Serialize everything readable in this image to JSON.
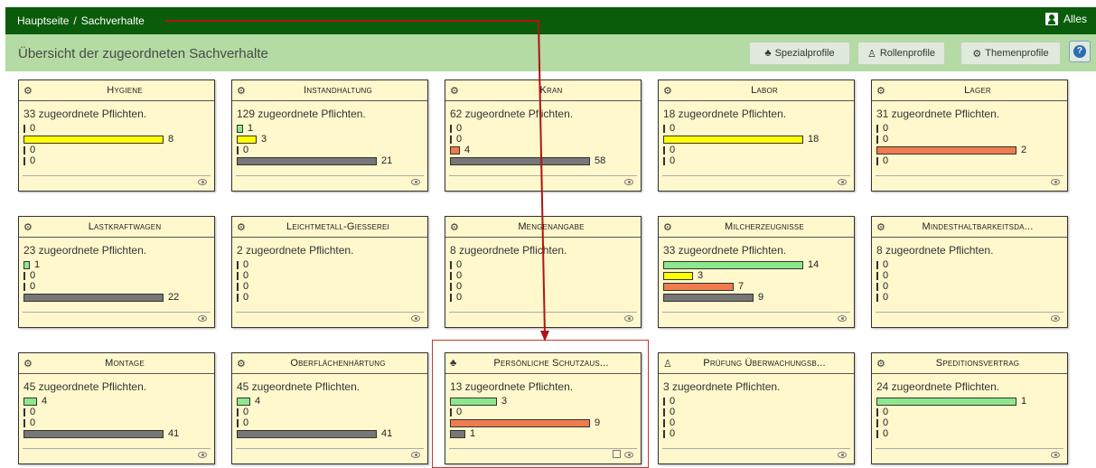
{
  "topbar": {
    "home": "Hauptseite",
    "separator": "/",
    "current": "Sachverhalte",
    "user": "Alles"
  },
  "subbar": {
    "title": "Übersicht der zugeordneten Sachverhalte",
    "buttons": [
      "Spezialprofile",
      "Rollenprofile",
      "Themenprofile"
    ]
  },
  "colors": {
    "green": "#8de88d",
    "yellow": "#ffff00",
    "red": "#f07b4f",
    "gray": "#777777"
  },
  "cards": [
    {
      "title": "Hygiene",
      "icon": "gears-icon",
      "count": "33 zugeordnete Pflichten.",
      "bars": [
        0,
        8,
        0,
        0
      ],
      "edit": false
    },
    {
      "title": "Instandhaltung",
      "icon": "gears-icon",
      "count": "129 zugeordnete Pflichten.",
      "bars": [
        1,
        3,
        0,
        21
      ],
      "edit": false
    },
    {
      "title": "Kran",
      "icon": "gears-icon",
      "count": "62 zugeordnete Pflichten.",
      "bars": [
        0,
        0,
        4,
        58
      ],
      "edit": false
    },
    {
      "title": "Labor",
      "icon": "gears-icon",
      "count": "18 zugeordnete Pflichten.",
      "bars": [
        0,
        18,
        0,
        0
      ],
      "edit": false
    },
    {
      "title": "Lager",
      "icon": "gears-icon",
      "count": "31 zugeordnete Pflichten.",
      "bars": [
        0,
        0,
        2,
        0
      ],
      "edit": false
    },
    {
      "title": "Lastkraftwagen",
      "icon": "gears-icon",
      "count": "23 zugeordnete Pflichten.",
      "bars": [
        1,
        0,
        0,
        22
      ],
      "edit": false
    },
    {
      "title": "Leichtmetall-Gießerei",
      "icon": "gears-icon",
      "count": "2 zugeordnete Pflichten.",
      "bars": [
        0,
        0,
        0,
        0
      ],
      "edit": false
    },
    {
      "title": "Mengenangabe",
      "icon": "gears-icon",
      "count": "8 zugeordnete Pflichten.",
      "bars": [
        0,
        0,
        0,
        0
      ],
      "edit": false
    },
    {
      "title": "Milcherzeugnisse",
      "icon": "gears-icon",
      "count": "33 zugeordnete Pflichten.",
      "bars": [
        14,
        3,
        7,
        9
      ],
      "edit": false
    },
    {
      "title": "Mindesthaltbarkeitsda...",
      "icon": "gears-icon",
      "count": "8 zugeordnete Pflichten.",
      "bars": [
        0,
        0,
        0,
        0
      ],
      "edit": false
    },
    {
      "title": "Montage",
      "icon": "gears-icon",
      "count": "45 zugeordnete Pflichten.",
      "bars": [
        4,
        0,
        0,
        41
      ],
      "edit": false
    },
    {
      "title": "Oberflächenhärtung",
      "icon": "gears-icon",
      "count": "45 zugeordnete Pflichten.",
      "bars": [
        4,
        0,
        0,
        41
      ],
      "edit": false
    },
    {
      "title": "Persönliche Schutzaus...",
      "icon": "puzzle-icon",
      "count": "13 zugeordnete Pflichten.",
      "bars": [
        3,
        0,
        9,
        1
      ],
      "edit": true
    },
    {
      "title": "Prüfung Überwachungsb...",
      "icon": "person-icon",
      "count": "3 zugeordnete Pflichten.",
      "bars": [
        0,
        0,
        0,
        0
      ],
      "edit": false
    },
    {
      "title": "Speditionsvertrag",
      "icon": "gears-icon",
      "count": "24 zugeordnete Pflichten.",
      "bars": [
        1,
        0,
        0,
        0
      ],
      "edit": false
    }
  ]
}
